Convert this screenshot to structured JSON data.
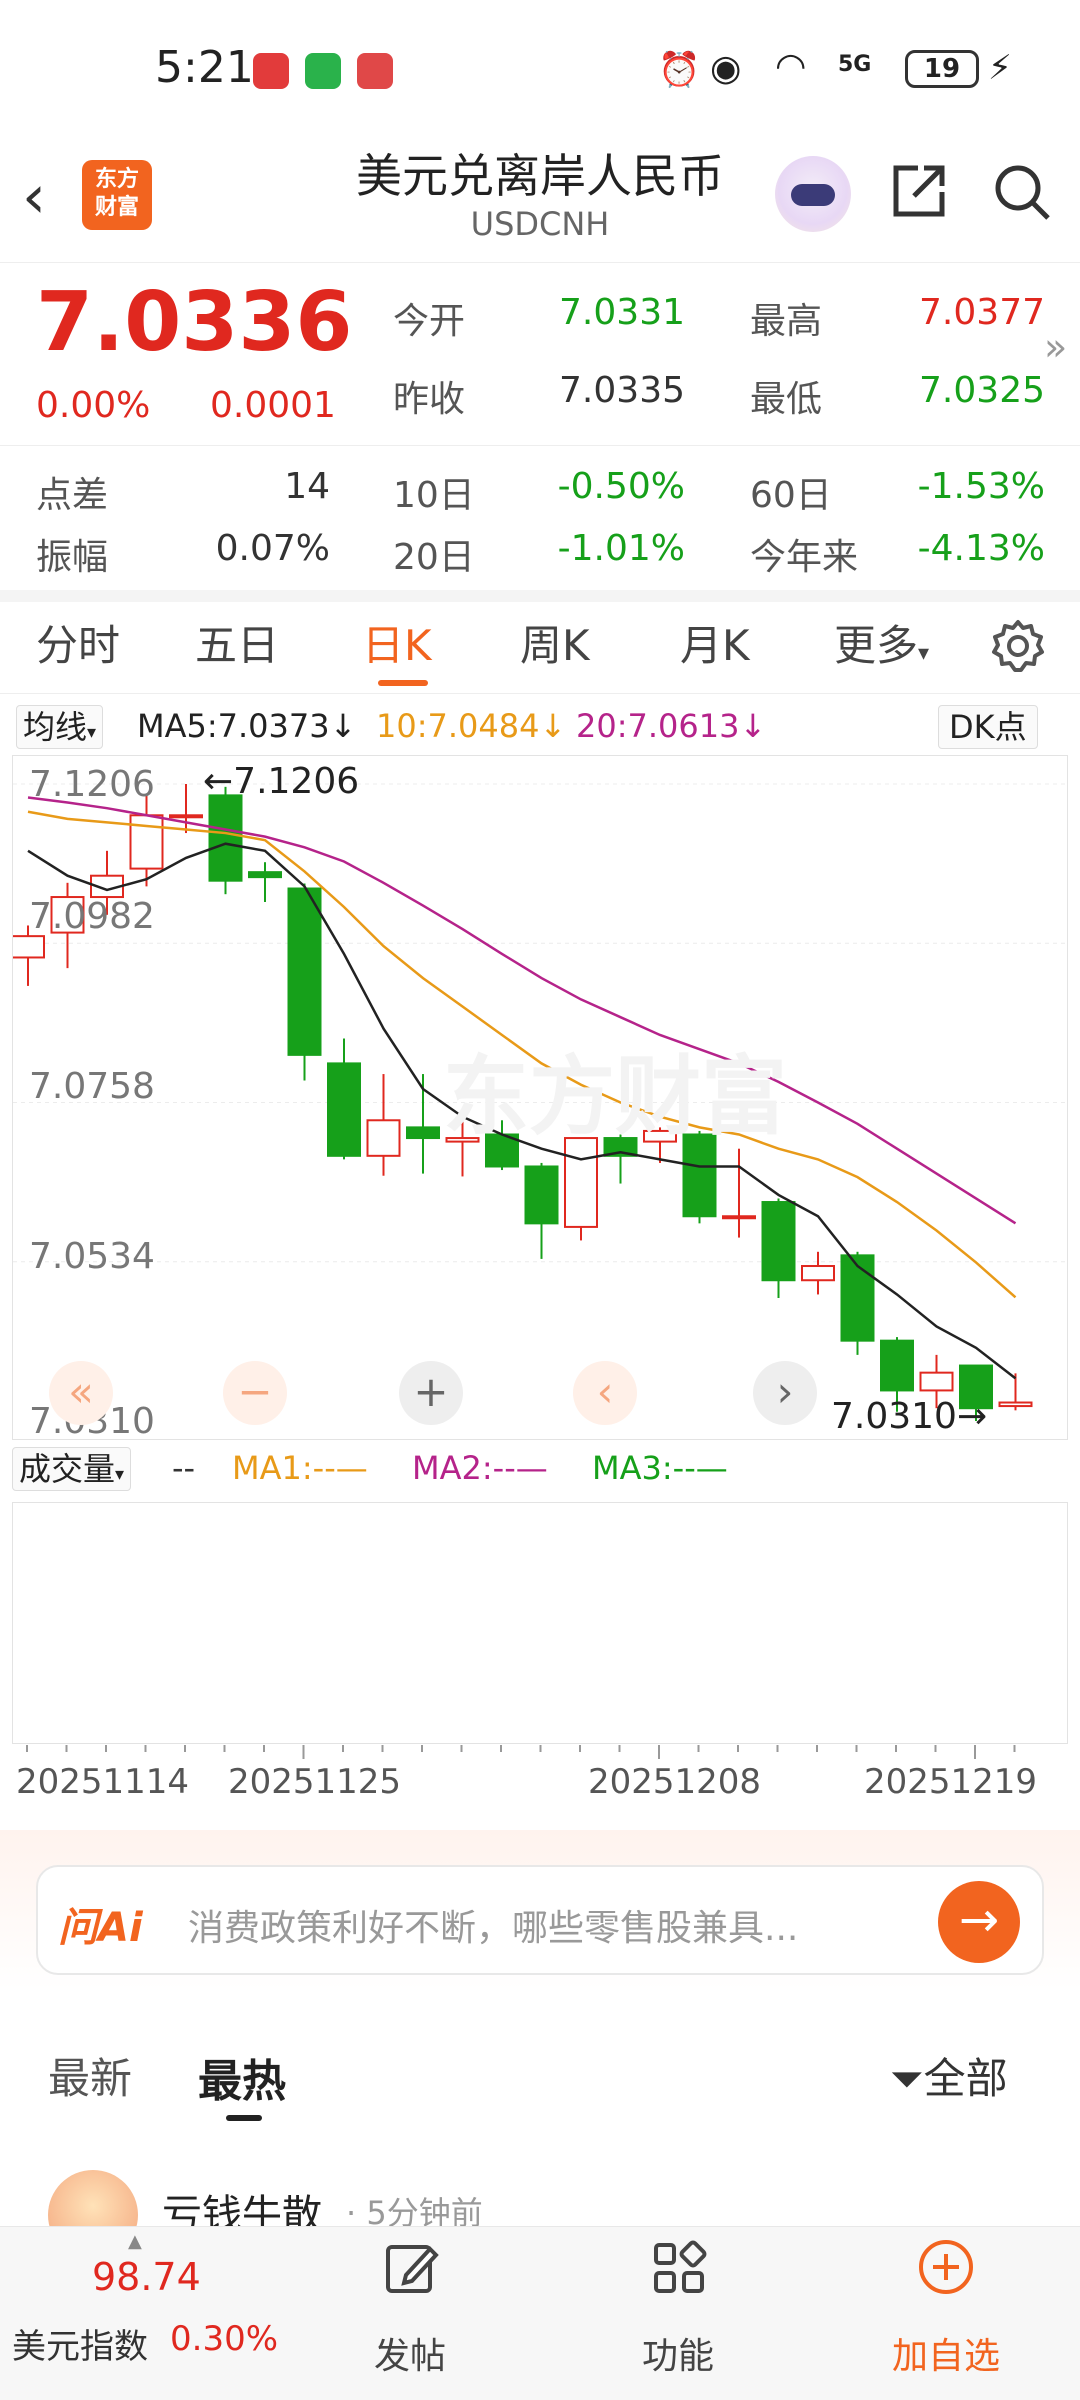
{
  "status_bar": {
    "time": "5:21",
    "signal_label": "5G",
    "battery": "19"
  },
  "header": {
    "logo_text_top": "东方",
    "logo_text_bottom": "财富",
    "title": "美元兑离岸人民币",
    "subtitle": "USDCNH"
  },
  "quote": {
    "price": "7.0336",
    "change_pct": "0.00%",
    "change_abs": "0.0001",
    "open_label": "今开",
    "open": "7.0331",
    "high_label": "最高",
    "high": "7.0377",
    "prev_close_label": "昨收",
    "prev_close": "7.0335",
    "low_label": "最低",
    "low": "7.0325",
    "spread_label": "点差",
    "spread": "14",
    "amplitude_label": "振幅",
    "amplitude": "0.07%",
    "d10_label": "10日",
    "d10": "-0.50%",
    "d20_label": "20日",
    "d20": "-1.01%",
    "d60_label": "60日",
    "d60": "-1.53%",
    "ytd_label": "今年来",
    "ytd": "-4.13%"
  },
  "tabs": {
    "intraday": "分时",
    "five_day": "五日",
    "daily": "日K",
    "weekly": "周K",
    "monthly": "月K",
    "more": "更多"
  },
  "indicator": {
    "selector": "均线",
    "ma5": "MA5:7.0373",
    "ma10": "10:7.0484",
    "ma20": "20:7.0613",
    "dk": "DK点",
    "color_ma5": "#222222",
    "color_ma10": "#e89a18",
    "color_ma20": "#b5238a"
  },
  "chart_data": {
    "type": "candlestick",
    "y_ticks": [
      "7.1206",
      "7.0982",
      "7.0758",
      "7.0534",
      "7.0310"
    ],
    "ylim": [
      7.031,
      7.1206
    ],
    "max_annotation": "7.1206",
    "min_annotation": "7.0310",
    "x_ticks": [
      "20251114",
      "20251125",
      "20251208",
      "20251219"
    ],
    "candles": [
      {
        "o": 7.0962,
        "c": 7.0992,
        "h": 7.1007,
        "l": 7.0922
      },
      {
        "o": 7.0997,
        "c": 7.1047,
        "h": 7.1067,
        "l": 7.0947
      },
      {
        "o": 7.1047,
        "c": 7.1077,
        "h": 7.1112,
        "l": 7.1022
      },
      {
        "o": 7.1087,
        "c": 7.1162,
        "h": 7.1192,
        "l": 7.1062
      },
      {
        "o": 7.1162,
        "c": 7.1162,
        "h": 7.1206,
        "l": 7.1137
      },
      {
        "o": 7.119,
        "c": 7.107,
        "h": 7.1202,
        "l": 7.1051
      },
      {
        "o": 7.1082,
        "c": 7.1075,
        "h": 7.1096,
        "l": 7.104
      },
      {
        "o": 7.1059,
        "c": 7.0825,
        "h": 7.1066,
        "l": 7.0789
      },
      {
        "o": 7.0813,
        "c": 7.0683,
        "h": 7.0848,
        "l": 7.0678
      },
      {
        "o": 7.0683,
        "c": 7.0733,
        "h": 7.0798,
        "l": 7.0655
      },
      {
        "o": 7.0723,
        "c": 7.0708,
        "h": 7.0798,
        "l": 7.0658
      },
      {
        "o": 7.0703,
        "c": 7.0708,
        "h": 7.0733,
        "l": 7.0654
      },
      {
        "o": 7.0713,
        "c": 7.0668,
        "h": 7.0733,
        "l": 7.0663
      },
      {
        "o": 7.0668,
        "c": 7.0588,
        "h": 7.0673,
        "l": 7.0538
      },
      {
        "o": 7.0583,
        "c": 7.0708,
        "h": 7.0708,
        "l": 7.0564
      },
      {
        "o": 7.0708,
        "c": 7.0683,
        "h": 7.0713,
        "l": 7.0644
      },
      {
        "o": 7.0703,
        "c": 7.0718,
        "h": 7.0723,
        "l": 7.0673
      },
      {
        "o": 7.0713,
        "c": 7.0598,
        "h": 7.0718,
        "l": 7.0588
      },
      {
        "o": 7.0598,
        "c": 7.0598,
        "h": 7.0693,
        "l": 7.0568
      },
      {
        "o": 7.0618,
        "c": 7.0508,
        "h": 7.0623,
        "l": 7.0483
      },
      {
        "o": 7.0508,
        "c": 7.0528,
        "h": 7.0548,
        "l": 7.0488
      },
      {
        "o": 7.0543,
        "c": 7.0423,
        "h": 7.0548,
        "l": 7.0403
      },
      {
        "o": 7.0423,
        "c": 7.0353,
        "h": 7.0428,
        "l": 7.0323
      },
      {
        "o": 7.0353,
        "c": 7.0378,
        "h": 7.0403,
        "l": 7.0328
      },
      {
        "o": 7.0388,
        "c": 7.0328,
        "h": 7.0388,
        "l": 7.031
      },
      {
        "o": 7.0331,
        "c": 7.0336,
        "h": 7.0377,
        "l": 7.0325
      }
    ],
    "ma5": [
      7.1112,
      7.1077,
      7.1057,
      7.1072,
      7.1102,
      7.1122,
      7.1112,
      7.1062,
      7.0967,
      7.0862,
      7.0777,
      7.0738,
      7.0713,
      7.0693,
      7.0678,
      7.0688,
      7.0678,
      7.0668,
      7.0668,
      7.0628,
      7.0598,
      7.0528,
      7.0488,
      7.0443,
      7.0413,
      7.037
    ],
    "ma10": [
      7.1167,
      7.1157,
      7.1152,
      7.1147,
      7.1142,
      7.1137,
      7.1127,
      7.1083,
      7.1033,
      7.0978,
      7.0933,
      7.0893,
      7.0853,
      7.0813,
      7.0783,
      7.0758,
      7.0738,
      7.0723,
      7.0713,
      7.0693,
      7.0678,
      7.0653,
      7.0618,
      7.0578,
      7.0533,
      7.0484
    ],
    "ma20": [
      7.1187,
      7.118,
      7.1172,
      7.1162,
      7.1152,
      7.1142,
      7.1132,
      7.1117,
      7.1097,
      7.1067,
      7.1035,
      7.1002,
      7.0967,
      7.0933,
      7.0903,
      7.0878,
      7.0853,
      7.0833,
      7.0813,
      7.0787,
      7.0758,
      7.0728,
      7.0693,
      7.0658,
      7.0623,
      7.0588
    ]
  },
  "volume": {
    "selector": "成交量",
    "value": "--",
    "ma1": "MA1:--",
    "ma2": "MA2:--",
    "ma3": "MA3:--",
    "color_ma1": "#e89a18",
    "color_ma2": "#b5238a",
    "color_ma3": "#16a01a"
  },
  "ai": {
    "brand": "问Ai",
    "placeholder": "消费政策利好不断，哪些零售股兼具..."
  },
  "feed": {
    "tab_latest": "最新",
    "tab_hot": "最热",
    "filter": "全部",
    "post_user": "亏钱牛散",
    "post_time": "5分钟前"
  },
  "bottom_nav": {
    "dxy_value": "98.74",
    "dxy_name": "美元指数",
    "dxy_change": "0.30%",
    "post": "发帖",
    "functions": "功能",
    "add_watch": "加自选"
  }
}
